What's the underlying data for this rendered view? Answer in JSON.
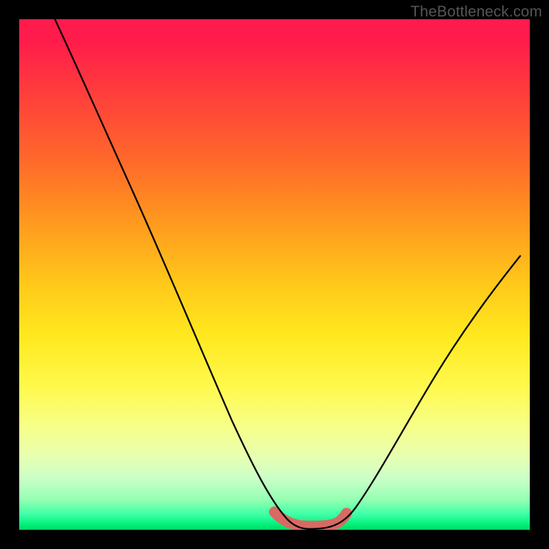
{
  "watermark": "TheBottleneck.com",
  "chart_data": {
    "type": "line",
    "title": "",
    "xlabel": "",
    "ylabel": "",
    "xlim": [
      0,
      100
    ],
    "ylim": [
      0,
      100
    ],
    "grid": false,
    "legend": false,
    "series": [
      {
        "name": "bottleneck-curve",
        "x": [
          7,
          12,
          18,
          24,
          30,
          36,
          42,
          47,
          50,
          53,
          55,
          58,
          60,
          63,
          66,
          70,
          75,
          80,
          86,
          92,
          98
        ],
        "y": [
          100,
          90,
          78,
          66,
          54,
          42,
          30,
          18,
          9,
          3,
          0,
          0,
          0,
          1,
          4,
          10,
          19,
          28,
          38,
          47,
          55
        ],
        "color_top": "#ff1b4c",
        "color_bottom": "#00d85e"
      }
    ],
    "highlight": {
      "name": "optimal-range",
      "x": [
        50,
        52,
        55,
        58,
        60,
        62,
        64
      ],
      "y": [
        3.5,
        1.5,
        0.5,
        0.5,
        0.5,
        1.0,
        3.0
      ],
      "stroke": "#d86a63",
      "stroke_width_px": 16
    },
    "background_gradient_stops": [
      {
        "pct": 0,
        "color": "#ff1b4c"
      },
      {
        "pct": 14,
        "color": "#ff3c3c"
      },
      {
        "pct": 28,
        "color": "#ff6a2a"
      },
      {
        "pct": 40,
        "color": "#ff9a1e"
      },
      {
        "pct": 52,
        "color": "#ffc91a"
      },
      {
        "pct": 62,
        "color": "#ffe81e"
      },
      {
        "pct": 80,
        "color": "#f6ff8a"
      },
      {
        "pct": 94,
        "color": "#96ffb3"
      },
      {
        "pct": 100,
        "color": "#00d85e"
      }
    ]
  }
}
